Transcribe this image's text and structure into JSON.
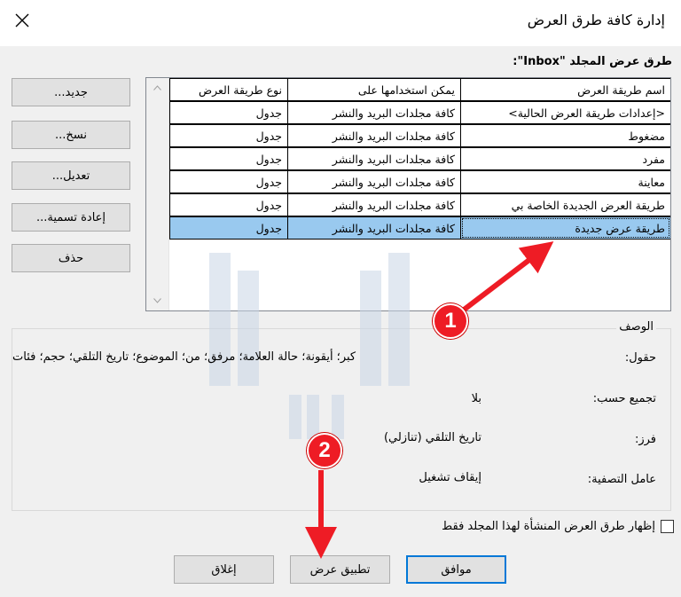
{
  "window": {
    "title": "إدارة كافة طرق العرض"
  },
  "group_label": "طرق عرض المجلد \"Inbox\":",
  "side_buttons": {
    "new": "جديد...",
    "copy": "نسخ...",
    "edit": "تعديل...",
    "rename": "إعادة تسمية...",
    "delete": "حذف"
  },
  "list": {
    "columns": [
      "اسم طريقة العرض",
      "يمكن استخدامها على",
      "نوع طريقة العرض"
    ],
    "rows": [
      {
        "name": "<إعدادات طريقة العرض الحالية>",
        "use": "كافة مجلدات البريد والنشر",
        "type": "جدول"
      },
      {
        "name": "مضغوط",
        "use": "كافة مجلدات البريد والنشر",
        "type": "جدول"
      },
      {
        "name": "مفرد",
        "use": "كافة مجلدات البريد والنشر",
        "type": "جدول"
      },
      {
        "name": "معاينة",
        "use": "كافة مجلدات البريد والنشر",
        "type": "جدول"
      },
      {
        "name": "طريقة العرض الجديدة الخاصة بي",
        "use": "كافة مجلدات البريد والنشر",
        "type": "جدول"
      },
      {
        "name": "طريقة عرض جديدة",
        "use": "كافة مجلدات البريد والنشر",
        "type": "جدول"
      }
    ]
  },
  "description": {
    "title": "الوصف",
    "fields_label": "حقول:",
    "fields_value": "كبر؛ أيقونة؛ حالة العلامة؛ مرفق؛ من؛ الموضوع؛ تاريخ التلقي؛ حجم؛ فئات",
    "group_label": "تجميع حسب:",
    "group_value": "بلا",
    "sort_label": "فرز:",
    "sort_value": "تاريخ التلقي (تنازلي)",
    "filter_label": "عامل التصفية:",
    "filter_value": "إيقاف تشغيل"
  },
  "checkbox": {
    "label": "إظهار طرق العرض المنشأة لهذا المجلد فقط"
  },
  "buttons": {
    "ok": "موافق",
    "apply": "تطبيق عرض",
    "close": "إغلاق"
  },
  "annotations": {
    "badge1": "1",
    "badge2": "2"
  },
  "colors": {
    "selection": "#99c9ef",
    "annotation": "#ee1c25",
    "default_border": "#0078d7"
  }
}
